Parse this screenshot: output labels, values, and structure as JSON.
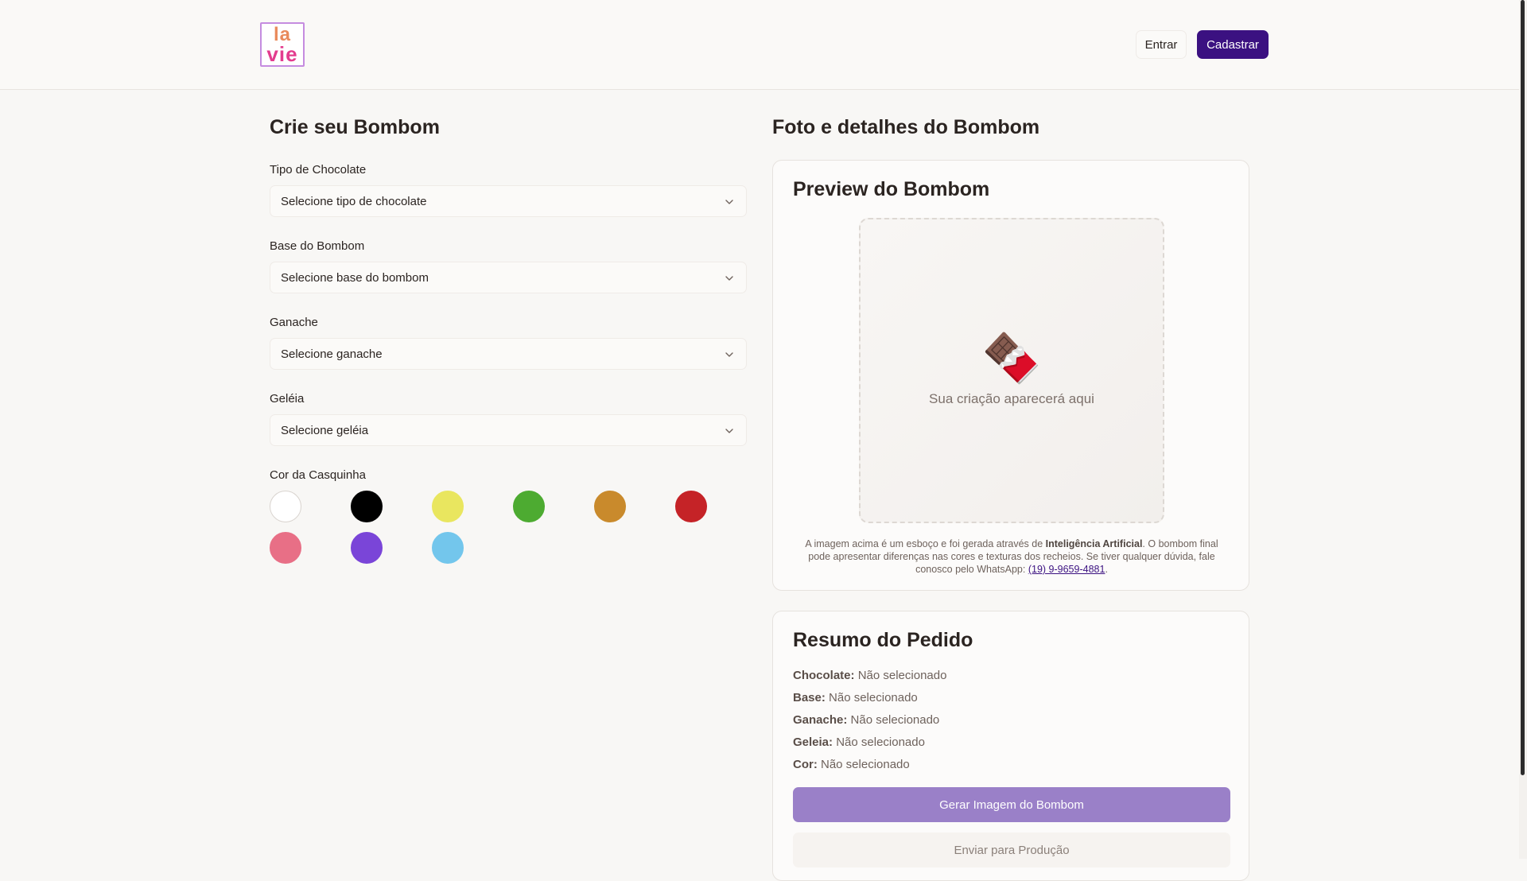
{
  "header": {
    "logo_line1": "la",
    "logo_line2": "vie",
    "login_label": "Entrar",
    "signup_label": "Cadastrar"
  },
  "builder": {
    "title": "Crie seu Bombom",
    "chocolate": {
      "label": "Tipo de Chocolate",
      "placeholder": "Selecione tipo de chocolate"
    },
    "base": {
      "label": "Base do Bombom",
      "placeholder": "Selecione base do bombom"
    },
    "ganache": {
      "label": "Ganache",
      "placeholder": "Selecione ganache"
    },
    "geleia": {
      "label": "Geléia",
      "placeholder": "Selecione geléia"
    },
    "shell_color_label": "Cor da Casquinha",
    "shell_colors": [
      "#ffffff",
      "#000000",
      "#e9e65f",
      "#4dab31",
      "#c98a2c",
      "#c52327",
      "#e86f86",
      "#7a45d8",
      "#73c6ec"
    ]
  },
  "details": {
    "title": "Foto e detalhes do Bombom",
    "preview": {
      "title": "Preview do Bombom",
      "emoji": "🍫",
      "placeholder_text": "Sua criação aparecerá aqui",
      "disclaimer_1": "A imagem acima é um esboço e foi gerada através de ",
      "disclaimer_bold": "Inteligência Artificial",
      "disclaimer_2": ". O bombom final pode apresentar diferenças nas cores e texturas dos recheios. Se tiver qualquer dúvida, fale conosco pelo WhatsApp: ",
      "whatsapp": "(19) 9-9659-4881",
      "disclaimer_end": "."
    },
    "summary": {
      "title": "Resumo do Pedido",
      "rows": [
        {
          "key": "Chocolate:",
          "value": "Não selecionado"
        },
        {
          "key": "Base:",
          "value": "Não selecionado"
        },
        {
          "key": "Ganache:",
          "value": "Não selecionado"
        },
        {
          "key": "Geleia:",
          "value": "Não selecionado"
        },
        {
          "key": "Cor:",
          "value": " Não selecionado"
        }
      ],
      "generate_label": "Gerar Imagem do Bombom",
      "send_label": "Enviar para Produção"
    }
  }
}
